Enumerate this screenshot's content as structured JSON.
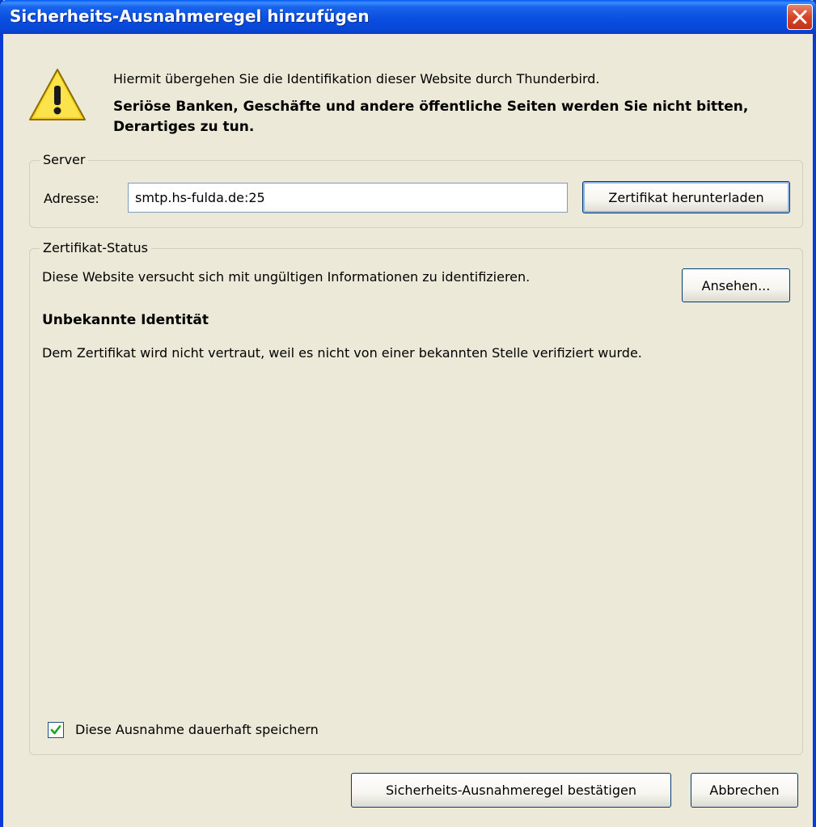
{
  "window": {
    "title": "Sicherheits-Ausnahmeregel hinzufügen",
    "close_icon": "close-icon"
  },
  "header": {
    "icon": "warning-icon",
    "info_text": "Hiermit übergehen Sie die Identifikation dieser Website durch Thunderbird.",
    "warning_text": "Seriöse Banken, Geschäfte und andere öffentliche Seiten werden Sie nicht bitten, Derartiges zu tun."
  },
  "server": {
    "legend": "Server",
    "address_label": "Adresse:",
    "address_value": "smtp.hs-fulda.de:25",
    "download_button": "Zertifikat herunterladen"
  },
  "cert_status": {
    "legend": "Zertifikat-Status",
    "message": "Diese Website versucht sich mit ungültigen Informationen zu identifizieren.",
    "view_button": "Ansehen...",
    "identity_title": "Unbekannte Identität",
    "identity_detail": "Dem Zertifikat wird nicht vertraut, weil es nicht von einer bekannten Stelle verifiziert wurde.",
    "permanent_checkbox_label": "Diese Ausnahme dauerhaft speichern",
    "permanent_checked": true
  },
  "footer": {
    "confirm_button": "Sicherheits-Ausnahmeregel bestätigen",
    "cancel_button": "Abbrechen"
  },
  "colors": {
    "titlebar": "#0a4fe0",
    "dialog_bg": "#ece9d8",
    "close_button": "#d4452a",
    "checkmark": "#21a121"
  }
}
